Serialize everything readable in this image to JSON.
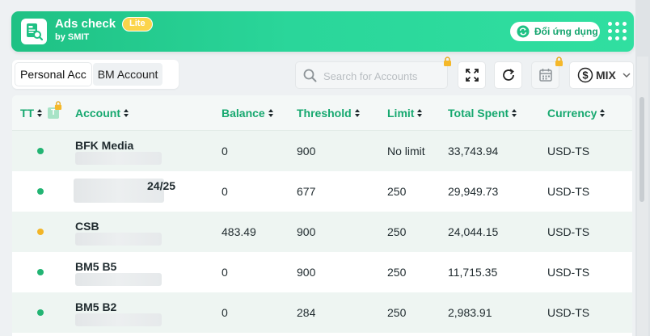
{
  "header": {
    "app_title": "Ads check",
    "badge": "Lite",
    "subtitle": "by SMIT",
    "switch_label": "Đổi ứng dụng",
    "logo_icon": "ads-document-search-icon",
    "menu_icon": "grid-dots-icon"
  },
  "tabs": [
    {
      "label": "Personal Acc",
      "active": true
    },
    {
      "label": "BM Account",
      "active": false
    }
  ],
  "search": {
    "placeholder": "Search for Accounts"
  },
  "toolbar": {
    "fullscreen_icon": "expand-icon",
    "refresh_icon": "refresh-icon",
    "calendar_icon": "calendar-icon",
    "currency_label": "MIX"
  },
  "table": {
    "headers": {
      "tt": "TT",
      "tt_badge": "T",
      "account": "Account",
      "balance": "Balance",
      "threshold": "Threshold",
      "limit": "Limit",
      "total_spent": "Total Spent",
      "currency": "Currency"
    },
    "rows": [
      {
        "status_color": "#22b473",
        "account": "BFK Media",
        "balance": "0",
        "threshold": "900",
        "limit": "No limit",
        "total_spent": "33,743.94",
        "currency": "USD-TS"
      },
      {
        "status_color": "#22b473",
        "account": "24/25",
        "balance": "0",
        "threshold": "677",
        "limit": "250",
        "total_spent": "29,949.73",
        "currency": "USD-TS"
      },
      {
        "status_color": "#f2b527",
        "account": "CSB",
        "balance": "483.49",
        "threshold": "900",
        "limit": "250",
        "total_spent": "24,044.15",
        "currency": "USD-TS"
      },
      {
        "status_color": "#22b473",
        "account": "BM5 B5",
        "balance": "0",
        "threshold": "900",
        "limit": "250",
        "total_spent": "11,715.35",
        "currency": "USD-TS"
      },
      {
        "status_color": "#22b473",
        "account": "BM5 B2",
        "balance": "0",
        "threshold": "284",
        "limit": "250",
        "total_spent": "2,983.91",
        "currency": "USD-TS"
      }
    ]
  },
  "colors": {
    "brand_green": "#1fc184",
    "header_text": "#16a86f",
    "badge_yellow": "#fbd44a",
    "status_active": "#22b473",
    "status_warning": "#f2b527"
  }
}
